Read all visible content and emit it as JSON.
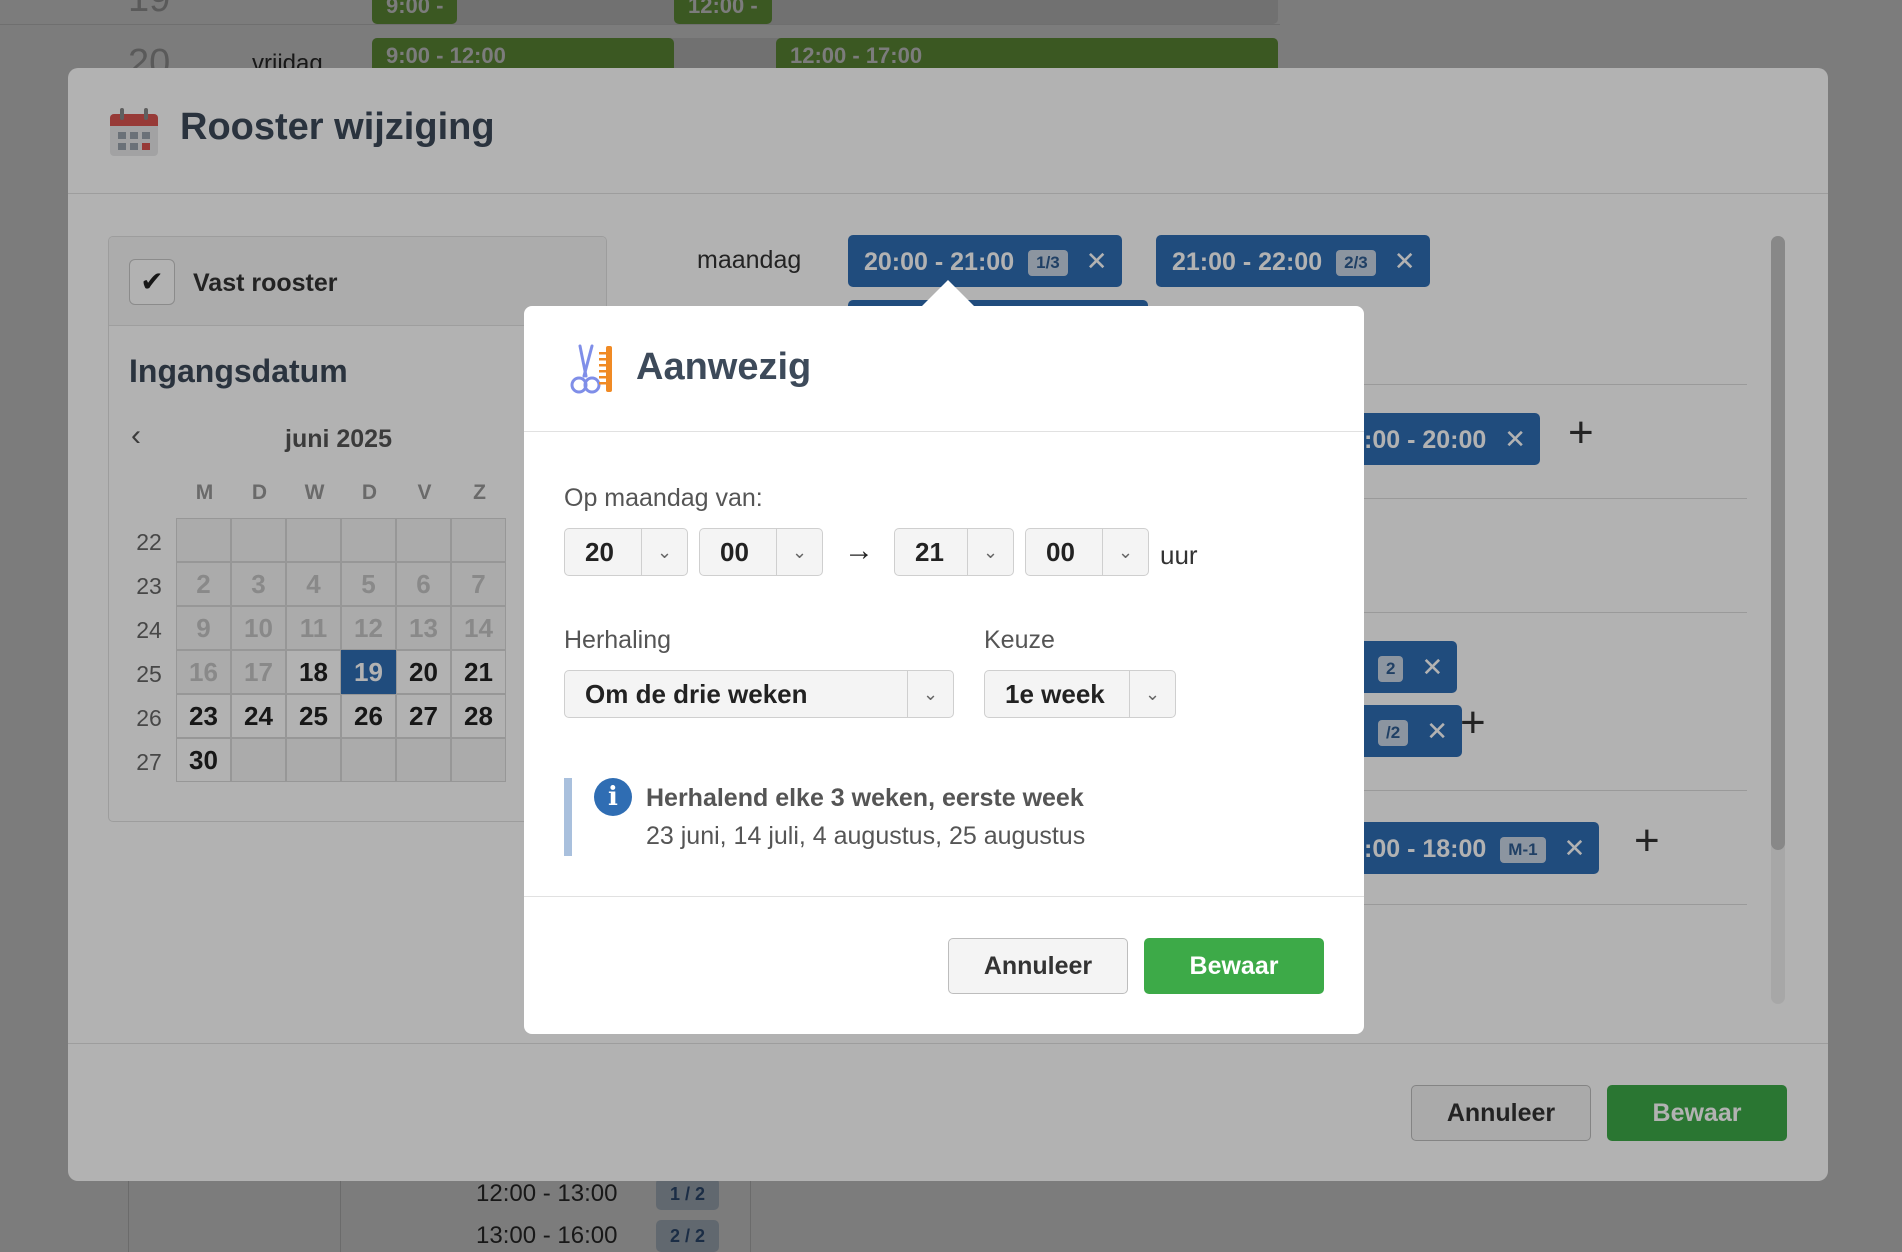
{
  "background": {
    "rows": [
      {
        "num": "19",
        "day": "",
        "chips": [
          "9:00 -",
          "12:00 -"
        ]
      },
      {
        "num": "20",
        "day": "vrijdag",
        "chips": [
          "9:00 - 12:00",
          "12:00 - 17:00"
        ]
      }
    ],
    "list": [
      {
        "time": "12:00 - 13:00",
        "tag": "1 / 2"
      },
      {
        "time": "13:00 - 16:00",
        "tag": "2 / 2"
      }
    ]
  },
  "modal": {
    "title": "Rooster wijziging",
    "fixed_schedule": {
      "label": "Vast rooster",
      "checked": true
    },
    "start_date": {
      "title": "Ingangsdatum",
      "month": "juni 2025",
      "weekdays": [
        "M",
        "D",
        "W",
        "D",
        "V",
        "Z"
      ],
      "weeks": [
        {
          "week": "22",
          "days": [
            "",
            "",
            "",
            "",
            "",
            ""
          ]
        },
        {
          "week": "23",
          "days": [
            "2",
            "3",
            "4",
            "5",
            "6",
            "7"
          ]
        },
        {
          "week": "24",
          "days": [
            "9",
            "10",
            "11",
            "12",
            "13",
            "14"
          ]
        },
        {
          "week": "25",
          "days": [
            "16",
            "17",
            "18",
            "19",
            "20",
            "21"
          ]
        },
        {
          "week": "26",
          "days": [
            "23",
            "24",
            "25",
            "26",
            "27",
            "28"
          ]
        },
        {
          "week": "27",
          "days": [
            "30",
            "",
            "",
            "",
            "",
            ""
          ]
        }
      ],
      "selected_day": "19"
    },
    "schedule": {
      "day": "maandag",
      "chips": [
        {
          "time": "20:00 - 21:00",
          "count": "1/3"
        },
        {
          "time": "21:00 - 22:00",
          "count": "2/3"
        },
        {
          "time": ":00 - 20:00",
          "count": ""
        },
        {
          "time": "",
          "count": "2"
        },
        {
          "time": "",
          "count": "/2"
        },
        {
          "time": ":00 - 18:00",
          "count": "M-1"
        }
      ]
    },
    "cancel_label": "Annuleer",
    "save_label": "Bewaar"
  },
  "popup": {
    "title": "Aanwezig",
    "from_label": "Op maandag van:",
    "start_hour": "20",
    "start_min": "00",
    "end_hour": "21",
    "end_min": "00",
    "unit": "uur",
    "repeat_label": "Herhaling",
    "repeat_value": "Om de drie weken",
    "choice_label": "Keuze",
    "choice_value": "1e week",
    "info_title": "Herhalend elke 3 weken, eerste week",
    "info_dates": "23 juni, 14 juli, 4 augustus, 25 augustus",
    "cancel_label": "Annuleer",
    "save_label": "Bewaar"
  },
  "colors": {
    "primary": "#2f6db3",
    "save": "#3daa48",
    "calendar_icon": "#d9534f",
    "app_icon": "#f08a24"
  }
}
